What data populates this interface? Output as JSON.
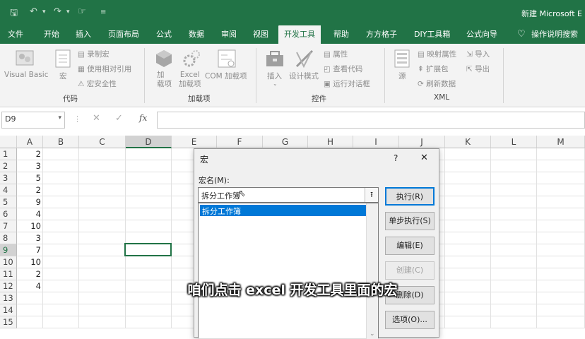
{
  "title_bar": {
    "document_title": "新建 Microsoft E"
  },
  "ribbon_tabs": [
    "文件",
    "开始",
    "插入",
    "页面布局",
    "公式",
    "数据",
    "审阅",
    "视图",
    "开发工具",
    "帮助",
    "方方格子",
    "DIY工具箱",
    "公式向导",
    "操作说明搜索"
  ],
  "ribbon": {
    "code_group": {
      "label": "代码",
      "visual_basic": "Visual Basic",
      "macros": "宏",
      "record_macro": "录制宏",
      "relative_refs": "使用相对引用",
      "macro_security": "宏安全性"
    },
    "addins_group": {
      "label": "加载项",
      "addins": "加\n载项",
      "excel_addins": "Excel\n加载项",
      "com_addins": "COM 加载项"
    },
    "controls_group": {
      "label": "控件",
      "insert": "插入",
      "design_mode": "设计模式",
      "properties": "属性",
      "view_code": "查看代码",
      "run_dialog": "运行对话框"
    },
    "xml_group": {
      "label": "XML",
      "source": "源",
      "map_properties": "映射属性",
      "expansion_packs": "扩展包",
      "refresh_data": "刷新数据",
      "import": "导入",
      "export": "导出"
    }
  },
  "formula_bar": {
    "name_box": "D9",
    "fx": "fx",
    "cancel": "✕",
    "enter": "✓"
  },
  "columns": [
    "A",
    "B",
    "C",
    "D",
    "E",
    "F",
    "G",
    "H",
    "I",
    "J",
    "K",
    "L",
    "M"
  ],
  "rows": [
    "1",
    "2",
    "3",
    "4",
    "5",
    "6",
    "7",
    "8",
    "9",
    "10",
    "11",
    "12",
    "13",
    "14",
    "15"
  ],
  "column_a_values": [
    "2",
    "3",
    "5",
    "2",
    "9",
    "4",
    "10",
    "3",
    "7",
    "10",
    "2",
    "4",
    "",
    "",
    ""
  ],
  "dialog": {
    "title": "宏",
    "help": "?",
    "close": "✕",
    "macro_name_label": "宏名(M):",
    "macro_name_value": "拆分工作簿",
    "macro_list": [
      "拆分工作簿"
    ],
    "buttons": {
      "run": "执行(R)",
      "step_into": "单步执行(S)",
      "edit": "编辑(E)",
      "create": "创建(C)",
      "delete": "删除(D)",
      "options": "选项(O)..."
    }
  },
  "subtitle": "咱们点击 excel 开发工具里面的宏",
  "colors": {
    "accent": "#217346",
    "selection": "#0078d7"
  }
}
